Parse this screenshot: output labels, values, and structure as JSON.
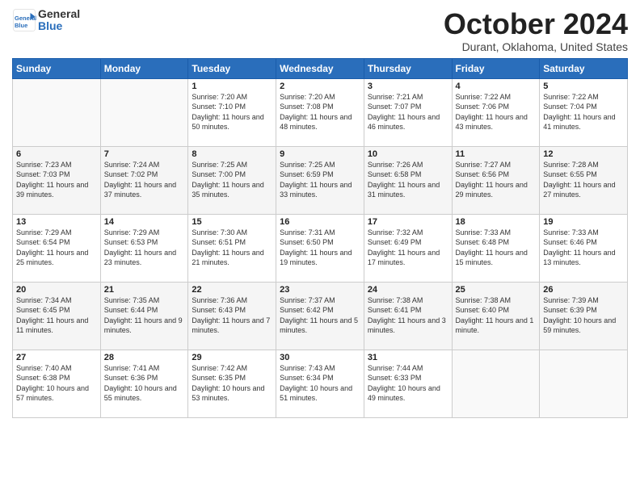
{
  "logo": {
    "line1": "General",
    "line2": "Blue"
  },
  "header": {
    "title": "October 2024",
    "subtitle": "Durant, Oklahoma, United States"
  },
  "weekdays": [
    "Sunday",
    "Monday",
    "Tuesday",
    "Wednesday",
    "Thursday",
    "Friday",
    "Saturday"
  ],
  "weeks": [
    [
      {
        "day": "",
        "sunrise": "",
        "sunset": "",
        "daylight": ""
      },
      {
        "day": "",
        "sunrise": "",
        "sunset": "",
        "daylight": ""
      },
      {
        "day": "1",
        "sunrise": "Sunrise: 7:20 AM",
        "sunset": "Sunset: 7:10 PM",
        "daylight": "Daylight: 11 hours and 50 minutes."
      },
      {
        "day": "2",
        "sunrise": "Sunrise: 7:20 AM",
        "sunset": "Sunset: 7:08 PM",
        "daylight": "Daylight: 11 hours and 48 minutes."
      },
      {
        "day": "3",
        "sunrise": "Sunrise: 7:21 AM",
        "sunset": "Sunset: 7:07 PM",
        "daylight": "Daylight: 11 hours and 46 minutes."
      },
      {
        "day": "4",
        "sunrise": "Sunrise: 7:22 AM",
        "sunset": "Sunset: 7:06 PM",
        "daylight": "Daylight: 11 hours and 43 minutes."
      },
      {
        "day": "5",
        "sunrise": "Sunrise: 7:22 AM",
        "sunset": "Sunset: 7:04 PM",
        "daylight": "Daylight: 11 hours and 41 minutes."
      }
    ],
    [
      {
        "day": "6",
        "sunrise": "Sunrise: 7:23 AM",
        "sunset": "Sunset: 7:03 PM",
        "daylight": "Daylight: 11 hours and 39 minutes."
      },
      {
        "day": "7",
        "sunrise": "Sunrise: 7:24 AM",
        "sunset": "Sunset: 7:02 PM",
        "daylight": "Daylight: 11 hours and 37 minutes."
      },
      {
        "day": "8",
        "sunrise": "Sunrise: 7:25 AM",
        "sunset": "Sunset: 7:00 PM",
        "daylight": "Daylight: 11 hours and 35 minutes."
      },
      {
        "day": "9",
        "sunrise": "Sunrise: 7:25 AM",
        "sunset": "Sunset: 6:59 PM",
        "daylight": "Daylight: 11 hours and 33 minutes."
      },
      {
        "day": "10",
        "sunrise": "Sunrise: 7:26 AM",
        "sunset": "Sunset: 6:58 PM",
        "daylight": "Daylight: 11 hours and 31 minutes."
      },
      {
        "day": "11",
        "sunrise": "Sunrise: 7:27 AM",
        "sunset": "Sunset: 6:56 PM",
        "daylight": "Daylight: 11 hours and 29 minutes."
      },
      {
        "day": "12",
        "sunrise": "Sunrise: 7:28 AM",
        "sunset": "Sunset: 6:55 PM",
        "daylight": "Daylight: 11 hours and 27 minutes."
      }
    ],
    [
      {
        "day": "13",
        "sunrise": "Sunrise: 7:29 AM",
        "sunset": "Sunset: 6:54 PM",
        "daylight": "Daylight: 11 hours and 25 minutes."
      },
      {
        "day": "14",
        "sunrise": "Sunrise: 7:29 AM",
        "sunset": "Sunset: 6:53 PM",
        "daylight": "Daylight: 11 hours and 23 minutes."
      },
      {
        "day": "15",
        "sunrise": "Sunrise: 7:30 AM",
        "sunset": "Sunset: 6:51 PM",
        "daylight": "Daylight: 11 hours and 21 minutes."
      },
      {
        "day": "16",
        "sunrise": "Sunrise: 7:31 AM",
        "sunset": "Sunset: 6:50 PM",
        "daylight": "Daylight: 11 hours and 19 minutes."
      },
      {
        "day": "17",
        "sunrise": "Sunrise: 7:32 AM",
        "sunset": "Sunset: 6:49 PM",
        "daylight": "Daylight: 11 hours and 17 minutes."
      },
      {
        "day": "18",
        "sunrise": "Sunrise: 7:33 AM",
        "sunset": "Sunset: 6:48 PM",
        "daylight": "Daylight: 11 hours and 15 minutes."
      },
      {
        "day": "19",
        "sunrise": "Sunrise: 7:33 AM",
        "sunset": "Sunset: 6:46 PM",
        "daylight": "Daylight: 11 hours and 13 minutes."
      }
    ],
    [
      {
        "day": "20",
        "sunrise": "Sunrise: 7:34 AM",
        "sunset": "Sunset: 6:45 PM",
        "daylight": "Daylight: 11 hours and 11 minutes."
      },
      {
        "day": "21",
        "sunrise": "Sunrise: 7:35 AM",
        "sunset": "Sunset: 6:44 PM",
        "daylight": "Daylight: 11 hours and 9 minutes."
      },
      {
        "day": "22",
        "sunrise": "Sunrise: 7:36 AM",
        "sunset": "Sunset: 6:43 PM",
        "daylight": "Daylight: 11 hours and 7 minutes."
      },
      {
        "day": "23",
        "sunrise": "Sunrise: 7:37 AM",
        "sunset": "Sunset: 6:42 PM",
        "daylight": "Daylight: 11 hours and 5 minutes."
      },
      {
        "day": "24",
        "sunrise": "Sunrise: 7:38 AM",
        "sunset": "Sunset: 6:41 PM",
        "daylight": "Daylight: 11 hours and 3 minutes."
      },
      {
        "day": "25",
        "sunrise": "Sunrise: 7:38 AM",
        "sunset": "Sunset: 6:40 PM",
        "daylight": "Daylight: 11 hours and 1 minute."
      },
      {
        "day": "26",
        "sunrise": "Sunrise: 7:39 AM",
        "sunset": "Sunset: 6:39 PM",
        "daylight": "Daylight: 10 hours and 59 minutes."
      }
    ],
    [
      {
        "day": "27",
        "sunrise": "Sunrise: 7:40 AM",
        "sunset": "Sunset: 6:38 PM",
        "daylight": "Daylight: 10 hours and 57 minutes."
      },
      {
        "day": "28",
        "sunrise": "Sunrise: 7:41 AM",
        "sunset": "Sunset: 6:36 PM",
        "daylight": "Daylight: 10 hours and 55 minutes."
      },
      {
        "day": "29",
        "sunrise": "Sunrise: 7:42 AM",
        "sunset": "Sunset: 6:35 PM",
        "daylight": "Daylight: 10 hours and 53 minutes."
      },
      {
        "day": "30",
        "sunrise": "Sunrise: 7:43 AM",
        "sunset": "Sunset: 6:34 PM",
        "daylight": "Daylight: 10 hours and 51 minutes."
      },
      {
        "day": "31",
        "sunrise": "Sunrise: 7:44 AM",
        "sunset": "Sunset: 6:33 PM",
        "daylight": "Daylight: 10 hours and 49 minutes."
      },
      {
        "day": "",
        "sunrise": "",
        "sunset": "",
        "daylight": ""
      },
      {
        "day": "",
        "sunrise": "",
        "sunset": "",
        "daylight": ""
      }
    ]
  ]
}
